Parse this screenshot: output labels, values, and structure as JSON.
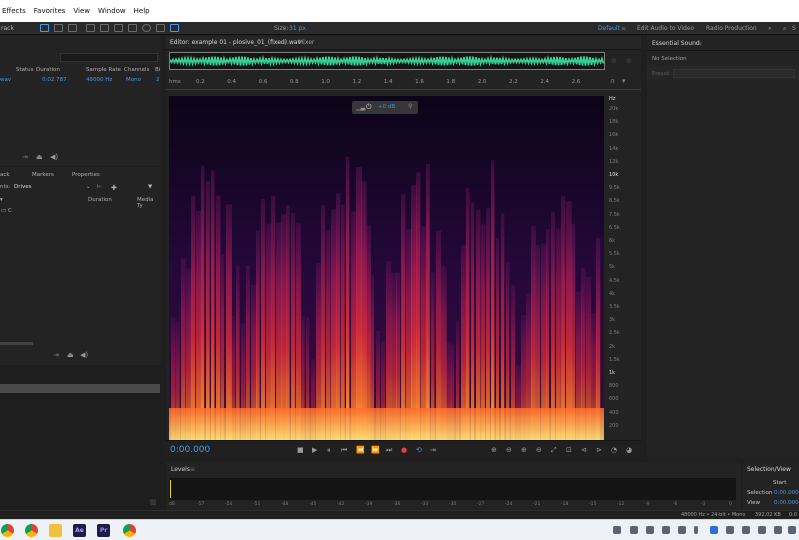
{
  "menubar": {
    "items": [
      "Effects",
      "Favorites",
      "View",
      "Window",
      "Help"
    ]
  },
  "toolbar": {
    "left_label": "rack",
    "size_label": "Size:",
    "size_value": "31 px",
    "workspaces": [
      "Default",
      "Edit Audio to Video",
      "Radio Production"
    ],
    "search_label": "S"
  },
  "files_panel": {
    "columns": [
      "Status",
      "Duration",
      "Sample Rate",
      "Channels",
      "Bi"
    ],
    "row": {
      "name": "wav",
      "duration": "0:02.787",
      "sample_rate": "48000 Hz",
      "channels": "Mono",
      "bits": "2"
    }
  },
  "media_panel": {
    "tabs": [
      "ack",
      "Markers",
      "Properties"
    ],
    "contents_label": "nts:",
    "contents_value": "Drives",
    "columns": [
      "Duration",
      "Media Ty"
    ],
    "drive": "C"
  },
  "editor": {
    "tab_title": "Editor: example 01 - plosive_01_(fixed).wav",
    "mixer_tab": "Mixer",
    "ruler_unit": "hms",
    "ruler_ticks": [
      "0.2",
      "0.4",
      "0.6",
      "0.8",
      "1.0",
      "1.2",
      "1.4",
      "1.6",
      "1.8",
      "2.0",
      "2.2",
      "2.4",
      "2.6"
    ],
    "hud_gain": "+0 dB",
    "freq_unit": "Hz",
    "freq_labels": [
      "20k",
      "18k",
      "16k",
      "14k",
      "12k",
      "10k",
      "9.5k",
      "8.5k",
      "7.5k",
      "6.5k",
      "6k",
      "5.5k",
      "5k",
      "4.5k",
      "4k",
      "3.5k",
      "3k",
      "2.5k",
      "2k",
      "1.5k",
      "1k",
      "800",
      "600",
      "400",
      "200"
    ],
    "freq_major": [
      "10k",
      "1k"
    ],
    "timecode": "0:00.000"
  },
  "essential_sound": {
    "title": "Essential Sound",
    "no_selection": "No Selection",
    "preset_label": "Preset:"
  },
  "levels": {
    "title": "Levels",
    "scale": [
      "dB",
      "-57",
      "-54",
      "-51",
      "-48",
      "-45",
      "-42",
      "-39",
      "-36",
      "-33",
      "-30",
      "-27",
      "-24",
      "-21",
      "-18",
      "-15",
      "-12",
      "-9",
      "-6",
      "-3",
      "0"
    ]
  },
  "selection_view": {
    "title": "Selection/View",
    "start_label": "Start",
    "selection_label": "Selection",
    "selection_start": "0:00.000",
    "view_label": "View",
    "view_start": "0:00.000"
  },
  "statusbar": {
    "format": "48000 Hz • 24-bit • Mono",
    "size": "392.02 KB",
    "duration": "0:0"
  },
  "taskbar": {
    "apps": [
      "Chrome",
      "Chrome Profile",
      "File Explorer",
      "Ae",
      "Pr",
      "Chrome 2"
    ]
  },
  "colors": {
    "accent": "#4a98e8",
    "record": "#e54141",
    "spectro_low": "#14051f",
    "spectro_high": "#ffd24a",
    "waveform": "#38d39a"
  }
}
